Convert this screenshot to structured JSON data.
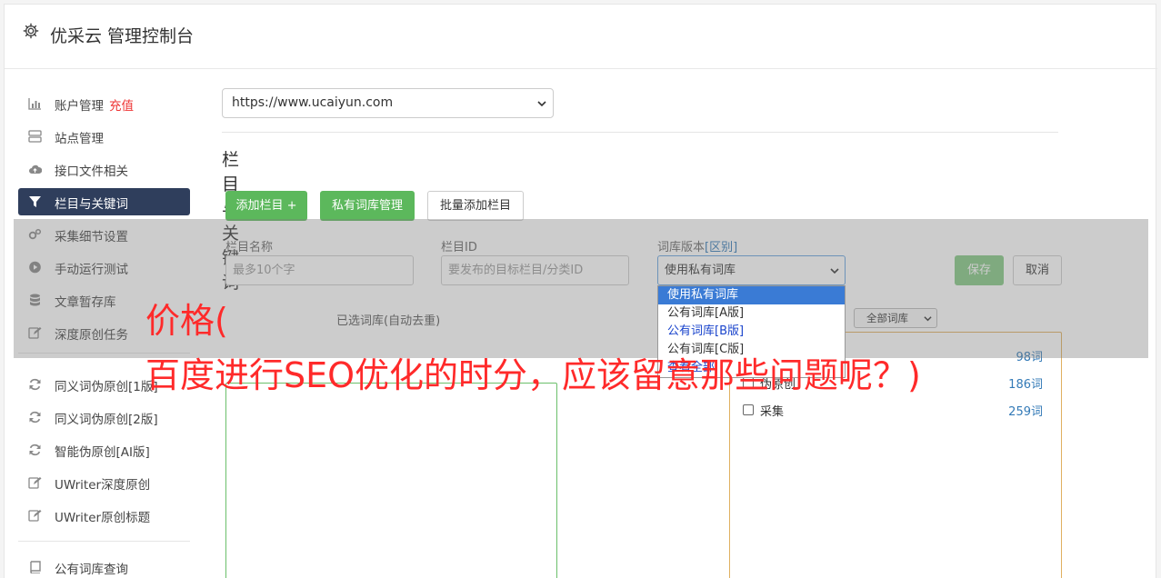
{
  "header": {
    "title": "优采云 管理控制台",
    "icon": "gear-icon"
  },
  "sidebar": {
    "items": [
      {
        "label": "账户管理",
        "extra": "充值",
        "icon": "bar-chart-icon"
      },
      {
        "label": "站点管理",
        "icon": "server-icon"
      },
      {
        "label": "接口文件相关",
        "icon": "cloud-upload-icon"
      },
      {
        "label": "栏目与关键词",
        "icon": "filter-icon",
        "active": true
      },
      {
        "label": "采集细节设置",
        "icon": "gears-icon"
      },
      {
        "label": "手动运行测试",
        "icon": "play-circle-icon"
      },
      {
        "label": "文章暂存库",
        "icon": "database-icon"
      },
      {
        "label": "深度原创任务",
        "icon": "edit-icon"
      },
      {
        "label": "同义词伪原创[1版]",
        "icon": "refresh-icon"
      },
      {
        "label": "同义词伪原创[2版]",
        "icon": "refresh-icon"
      },
      {
        "label": "智能伪原创[AI版]",
        "icon": "refresh-icon"
      },
      {
        "label": "UWriter深度原创",
        "icon": "edit-icon"
      },
      {
        "label": "UWriter原创标题",
        "icon": "edit-icon"
      },
      {
        "label": "公有词库查询",
        "icon": "book-icon"
      }
    ]
  },
  "main": {
    "site_select": "https://www.ucaiyun.com",
    "section_title": "栏目与关键词",
    "buttons": {
      "add_column": "添加栏目 +",
      "private_lib": "私有词库管理",
      "batch_add": "批量添加栏目",
      "save": "保存",
      "cancel": "取消"
    },
    "form": {
      "name_label": "栏目名称",
      "name_placeholder": "最多10个字",
      "id_label": "栏目ID",
      "id_placeholder": "要发布的目标栏目/分类ID",
      "version_label": "词库版本",
      "version_link": "[区别]",
      "version_value": "使用私有词库",
      "version_options": [
        "使用私有词库",
        "公有词库[A版]",
        "公有词库[B版]",
        "公有词库[C版]",
        "查看全部"
      ]
    },
    "selected_lib_label": "已选词库(自动去重)",
    "all_lib_select": "全部词库",
    "libraries": [
      {
        "name": "",
        "count": "98词"
      },
      {
        "name": "伪原创",
        "count": "186词"
      },
      {
        "name": "采集",
        "count": "259词"
      }
    ]
  },
  "overlay_caption": {
    "line1": "价格(",
    "line2": "百度进行SEO优化的时分，应该留意那些问题呢？)"
  },
  "colors": {
    "accent_green": "#5cb85c",
    "active_nav": "#2f3e5c",
    "caption_red": "#ff2a2a",
    "link_blue": "#337ab7"
  }
}
